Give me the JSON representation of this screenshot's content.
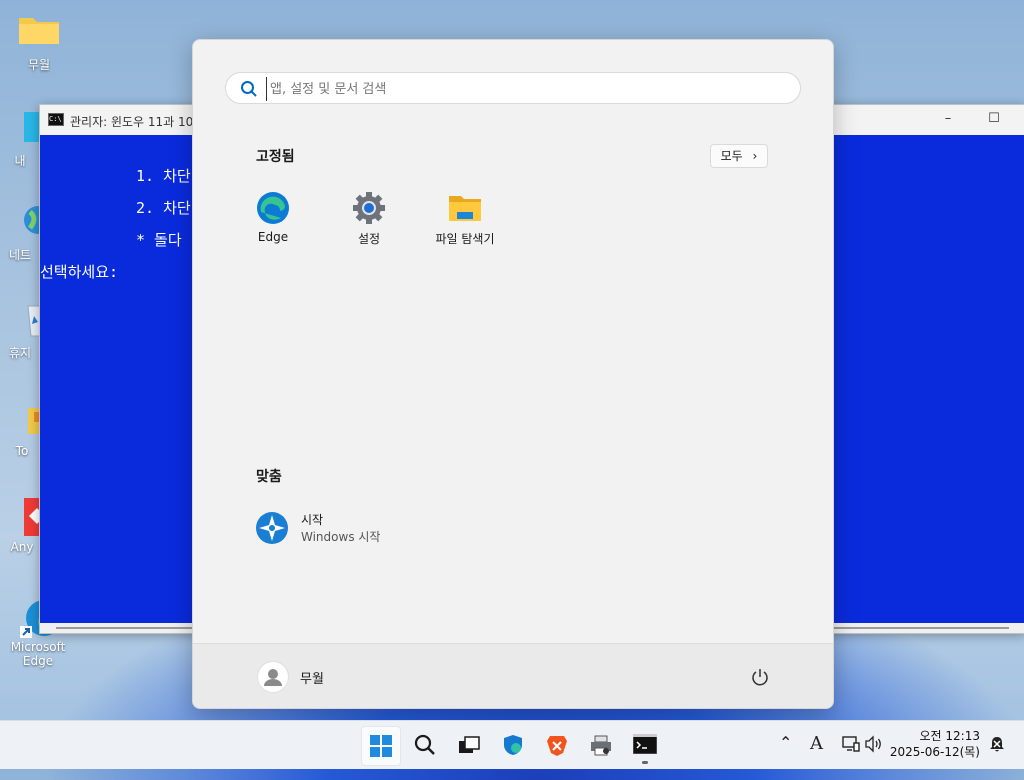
{
  "desktop": {
    "icons": [
      {
        "label": "무월"
      },
      {
        "label": "내"
      },
      {
        "label": "네트"
      },
      {
        "label": "휴지"
      },
      {
        "label": "To"
      },
      {
        "label": "Any"
      },
      {
        "label": "Microsoft Edge"
      }
    ]
  },
  "cmd": {
    "title": "관리자: 윈도우 11과 10",
    "lines": [
      "1. 차단",
      "2. 차단",
      "* 돌다",
      "선택하세요:"
    ],
    "bg_color": "#0a2bdc"
  },
  "start": {
    "search_placeholder": "앱, 설정 및 문서 검색",
    "pinned_title": "고정됨",
    "all_button": "모두",
    "pinned_apps": [
      {
        "label": "Edge",
        "icon": "edge-icon"
      },
      {
        "label": "설정",
        "icon": "gear-icon"
      },
      {
        "label": "파일 탐색기",
        "icon": "folder-icon"
      }
    ],
    "recommended_title": "맞춤",
    "recommended": [
      {
        "title": "시작",
        "subtitle": "Windows 시작",
        "icon": "get-started-icon"
      }
    ],
    "user": "무월"
  },
  "taskbar": {
    "apps": [
      "windows-start-icon",
      "search-icon",
      "task-view-icon",
      "defender-icon",
      "brave-icon",
      "printer-icon",
      "terminal-icon"
    ],
    "clock_time": "오전 12:13",
    "clock_date": "2025-06-12(목)",
    "input_indicator": "A",
    "accent": "#0067c0"
  }
}
